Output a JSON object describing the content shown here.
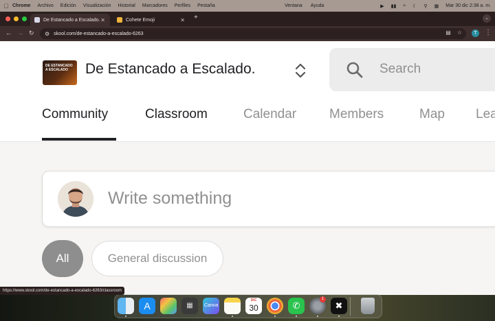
{
  "menubar": {
    "app": "Chrome",
    "items": [
      "Archivo",
      "Edición",
      "Visualización",
      "Historial",
      "Marcadores",
      "Perfiles",
      "Pestaña"
    ],
    "mid_items": [
      "Ventana",
      "Ayuda"
    ],
    "clock": "Mar 30 dic 2:38 a. m."
  },
  "browser": {
    "tabs": [
      {
        "title": "De Estancado a Escalado."
      },
      {
        "title": "Cohete Emoji"
      }
    ],
    "new_tab": "+",
    "url": "skool.com/de-estancado-a-escalado-6263",
    "profile_initial": "T",
    "status_url": "https://www.skool.com/de-estancado-a-escalado-6263/classroom"
  },
  "logo": {
    "text": "DE ESTANCADO A ESCALADO"
  },
  "header": {
    "title": "De Estancado a Escalado.",
    "search_placeholder": "Search"
  },
  "nav": {
    "tabs": [
      {
        "label": "Community"
      },
      {
        "label": "Classroom"
      },
      {
        "label": "Calendar"
      },
      {
        "label": "Members"
      },
      {
        "label": "Map"
      },
      {
        "label": "Lea"
      }
    ]
  },
  "composer": {
    "placeholder": "Write something"
  },
  "filters": {
    "all": "All",
    "general": "General discussion"
  },
  "dock": {
    "calendar_month": "DIC",
    "calendar_day": "30",
    "settings_badge": "1",
    "canva_label": "Canva"
  },
  "colors": {
    "accent_dark": "#202124",
    "muted": "#909090",
    "tab_bar": "#2a1f1e",
    "toolbar": "#3e2f2e"
  }
}
